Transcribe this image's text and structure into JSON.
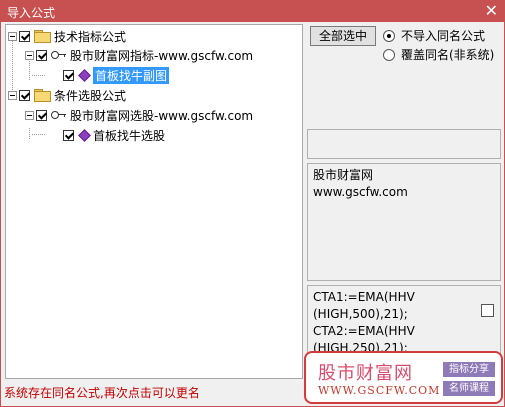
{
  "window": {
    "title": "导入公式",
    "close_glyph": "✕"
  },
  "tree": {
    "nodes": [
      {
        "label": "技术指标公式"
      },
      {
        "label": "股市财富网指标-www.gscfw.com"
      },
      {
        "label": "首板找牛副图"
      },
      {
        "label": "条件选股公式"
      },
      {
        "label": "股市财富网选股-www.gscfw.com"
      },
      {
        "label": "首板找牛选股"
      }
    ]
  },
  "buttons": {
    "select_all": "全部选中"
  },
  "options": {
    "skip_same_name": "不导入同名公式",
    "overwrite_same_name": "覆盖同名(非系统)"
  },
  "info": {
    "line1": "股市财富网",
    "line2": "www.gscfw.com"
  },
  "code": {
    "lines": [
      "CTA1:=EMA(HHV",
      "(HIGH,500),21);",
      "CTA2:=EMA(HHV",
      "(HIGH,250),21);"
    ]
  },
  "status": "系统存在同名公式,再次点击可以更名",
  "watermark": {
    "site": "股市财富网",
    "url": "WWW.GSCFW.COM",
    "badge1": "指标分享",
    "badge2": "名师课程"
  },
  "colors": {
    "titlebar": "#c75050",
    "selection": "#3399ff",
    "status_text": "#c00000"
  }
}
